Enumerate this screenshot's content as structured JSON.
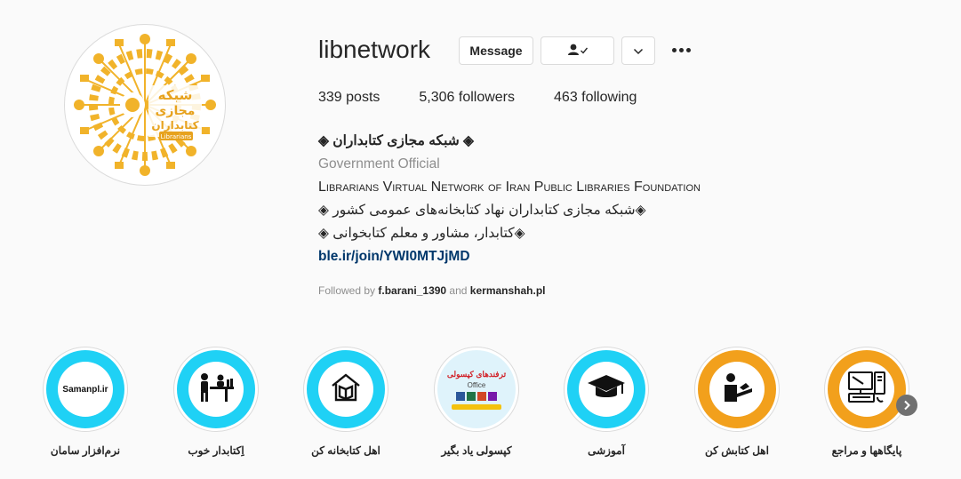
{
  "profile": {
    "username": "libnetwork",
    "message_label": "Message",
    "stats": {
      "posts": "339 posts",
      "followers": "5,306 followers",
      "following": "463 following"
    },
    "bio": {
      "name": "◈ شبکه مجازی کتابداران ◈",
      "category": "Government Official",
      "line1": "Librarians Virtual Network of Iran Public Libraries Foundation",
      "line2": "◈شبکه مجازی کتابداران نهاد کتابخانه‌های عمومی کشور ◈",
      "line3": "◈کتابدار، مشاور و معلم کتابخوانی ◈",
      "link": "ble.ir/join/YWI0MTJjMD"
    },
    "followed_by": {
      "prefix": "Followed by ",
      "user1": "f.barani_1390",
      "and": " and ",
      "user2": "kermanshah.pl"
    },
    "logo_text": {
      "top": "شبکه",
      "mid": "مجازی",
      "bottom": "کتابداران",
      "latin": "Librarians"
    }
  },
  "highlights": [
    {
      "label": "نرم‌افزار سامان",
      "cover_text": "Samanpl.ir",
      "icon": "samanpl-text"
    },
    {
      "label": "اِکتابدار خوب",
      "icon": "librarian-desk-icon"
    },
    {
      "label": "اهل کتابخانه کن",
      "icon": "book-house-icon"
    },
    {
      "label": "کپسولی یاد بگیر",
      "cover_text": "ترفندهای کپسولی",
      "cover_subtext": "Office",
      "icon": "office-cover"
    },
    {
      "label": "آموزشی",
      "icon": "graduation-cap-icon"
    },
    {
      "label": "اهل کتابش کن",
      "icon": "reading-person-icon"
    },
    {
      "label": "پایگاهها و مراجع",
      "icon": "computer-icon"
    }
  ],
  "colors": {
    "accent_cyan": "#1fd1f5",
    "accent_orange": "#f2a01c",
    "logo_gold": "#f1b32a",
    "link": "#00376b"
  }
}
